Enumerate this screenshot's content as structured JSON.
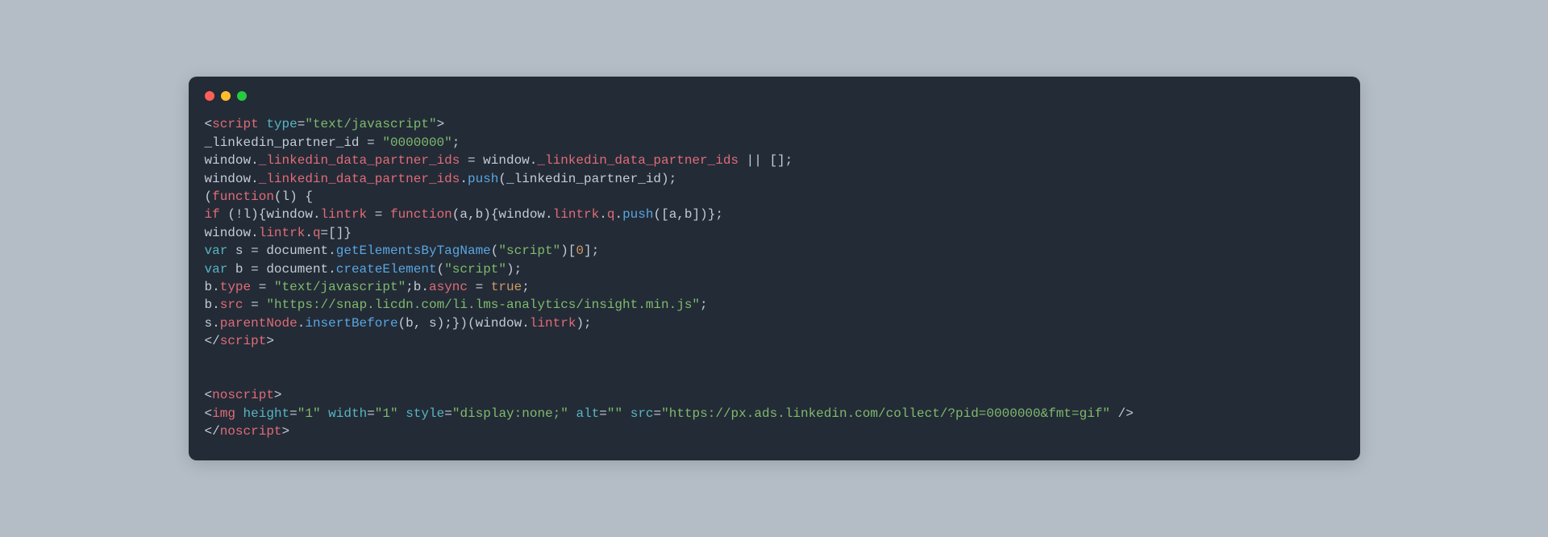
{
  "window": {
    "traffic_lights": [
      "red",
      "yellow",
      "green"
    ]
  },
  "code": {
    "lines": [
      [
        {
          "t": "<",
          "c": "punct"
        },
        {
          "t": "script",
          "c": "tag"
        },
        {
          "t": " ",
          "c": "punct"
        },
        {
          "t": "type",
          "c": "attr"
        },
        {
          "t": "=",
          "c": "punct"
        },
        {
          "t": "\"text/javascript\"",
          "c": "string"
        },
        {
          "t": ">",
          "c": "punct"
        }
      ],
      [
        {
          "t": "_linkedin_partner_id ",
          "c": "ident"
        },
        {
          "t": "= ",
          "c": "punct"
        },
        {
          "t": "\"0000000\"",
          "c": "string"
        },
        {
          "t": ";",
          "c": "punct"
        }
      ],
      [
        {
          "t": "window",
          "c": "ident"
        },
        {
          "t": ".",
          "c": "punct"
        },
        {
          "t": "_linkedin_data_partner_ids",
          "c": "prop"
        },
        {
          "t": " = ",
          "c": "punct"
        },
        {
          "t": "window",
          "c": "ident"
        },
        {
          "t": ".",
          "c": "punct"
        },
        {
          "t": "_linkedin_data_partner_ids",
          "c": "prop"
        },
        {
          "t": " || [];",
          "c": "punct"
        }
      ],
      [
        {
          "t": "window",
          "c": "ident"
        },
        {
          "t": ".",
          "c": "punct"
        },
        {
          "t": "_linkedin_data_partner_ids",
          "c": "prop"
        },
        {
          "t": ".",
          "c": "punct"
        },
        {
          "t": "push",
          "c": "func"
        },
        {
          "t": "(",
          "c": "punct"
        },
        {
          "t": "_linkedin_partner_id",
          "c": "ident"
        },
        {
          "t": ");",
          "c": "punct"
        }
      ],
      [
        {
          "t": "(",
          "c": "punct"
        },
        {
          "t": "function",
          "c": "keyword"
        },
        {
          "t": "(",
          "c": "punct"
        },
        {
          "t": "l",
          "c": "ident"
        },
        {
          "t": ") {",
          "c": "punct"
        }
      ],
      [
        {
          "t": "if ",
          "c": "keyword"
        },
        {
          "t": "(!",
          "c": "punct"
        },
        {
          "t": "l",
          "c": "ident"
        },
        {
          "t": "){",
          "c": "punct"
        },
        {
          "t": "window",
          "c": "ident"
        },
        {
          "t": ".",
          "c": "punct"
        },
        {
          "t": "lintrk",
          "c": "prop"
        },
        {
          "t": " = ",
          "c": "punct"
        },
        {
          "t": "function",
          "c": "keyword"
        },
        {
          "t": "(",
          "c": "punct"
        },
        {
          "t": "a",
          "c": "ident"
        },
        {
          "t": ",",
          "c": "punct"
        },
        {
          "t": "b",
          "c": "ident"
        },
        {
          "t": "){",
          "c": "punct"
        },
        {
          "t": "window",
          "c": "ident"
        },
        {
          "t": ".",
          "c": "punct"
        },
        {
          "t": "lintrk",
          "c": "prop"
        },
        {
          "t": ".",
          "c": "punct"
        },
        {
          "t": "q",
          "c": "prop"
        },
        {
          "t": ".",
          "c": "punct"
        },
        {
          "t": "push",
          "c": "func"
        },
        {
          "t": "([",
          "c": "punct"
        },
        {
          "t": "a",
          "c": "ident"
        },
        {
          "t": ",",
          "c": "punct"
        },
        {
          "t": "b",
          "c": "ident"
        },
        {
          "t": "])};",
          "c": "punct"
        }
      ],
      [
        {
          "t": "window",
          "c": "ident"
        },
        {
          "t": ".",
          "c": "punct"
        },
        {
          "t": "lintrk",
          "c": "prop"
        },
        {
          "t": ".",
          "c": "punct"
        },
        {
          "t": "q",
          "c": "prop"
        },
        {
          "t": "=[]}",
          "c": "punct"
        }
      ],
      [
        {
          "t": "var",
          "c": "var"
        },
        {
          "t": " s = ",
          "c": "ident"
        },
        {
          "t": "document",
          "c": "ident"
        },
        {
          "t": ".",
          "c": "punct"
        },
        {
          "t": "getElementsByTagName",
          "c": "func"
        },
        {
          "t": "(",
          "c": "punct"
        },
        {
          "t": "\"script\"",
          "c": "string"
        },
        {
          "t": ")[",
          "c": "punct"
        },
        {
          "t": "0",
          "c": "num"
        },
        {
          "t": "];",
          "c": "punct"
        }
      ],
      [
        {
          "t": "var",
          "c": "var"
        },
        {
          "t": " b = ",
          "c": "ident"
        },
        {
          "t": "document",
          "c": "ident"
        },
        {
          "t": ".",
          "c": "punct"
        },
        {
          "t": "createElement",
          "c": "func"
        },
        {
          "t": "(",
          "c": "punct"
        },
        {
          "t": "\"script\"",
          "c": "string"
        },
        {
          "t": ");",
          "c": "punct"
        }
      ],
      [
        {
          "t": "b",
          "c": "ident"
        },
        {
          "t": ".",
          "c": "punct"
        },
        {
          "t": "type",
          "c": "prop"
        },
        {
          "t": " = ",
          "c": "punct"
        },
        {
          "t": "\"text/javascript\"",
          "c": "string"
        },
        {
          "t": ";",
          "c": "punct"
        },
        {
          "t": "b",
          "c": "ident"
        },
        {
          "t": ".",
          "c": "punct"
        },
        {
          "t": "async",
          "c": "prop"
        },
        {
          "t": " = ",
          "c": "punct"
        },
        {
          "t": "true",
          "c": "bool"
        },
        {
          "t": ";",
          "c": "punct"
        }
      ],
      [
        {
          "t": "b",
          "c": "ident"
        },
        {
          "t": ".",
          "c": "punct"
        },
        {
          "t": "src",
          "c": "prop"
        },
        {
          "t": " = ",
          "c": "punct"
        },
        {
          "t": "\"https://snap.licdn.com/li.lms-analytics/insight.min.js\"",
          "c": "string"
        },
        {
          "t": ";",
          "c": "punct"
        }
      ],
      [
        {
          "t": "s",
          "c": "ident"
        },
        {
          "t": ".",
          "c": "punct"
        },
        {
          "t": "parentNode",
          "c": "prop"
        },
        {
          "t": ".",
          "c": "punct"
        },
        {
          "t": "insertBefore",
          "c": "func"
        },
        {
          "t": "(",
          "c": "punct"
        },
        {
          "t": "b",
          "c": "ident"
        },
        {
          "t": ", ",
          "c": "punct"
        },
        {
          "t": "s",
          "c": "ident"
        },
        {
          "t": ");})(",
          "c": "punct"
        },
        {
          "t": "window",
          "c": "ident"
        },
        {
          "t": ".",
          "c": "punct"
        },
        {
          "t": "lintrk",
          "c": "prop"
        },
        {
          "t": ");",
          "c": "punct"
        }
      ],
      [
        {
          "t": "</",
          "c": "punct"
        },
        {
          "t": "script",
          "c": "tag"
        },
        {
          "t": ">",
          "c": "punct"
        }
      ],
      [],
      [],
      [
        {
          "t": "<",
          "c": "punct"
        },
        {
          "t": "noscript",
          "c": "tag"
        },
        {
          "t": ">",
          "c": "punct"
        }
      ],
      [
        {
          "t": "<",
          "c": "punct"
        },
        {
          "t": "img",
          "c": "tag"
        },
        {
          "t": " ",
          "c": "punct"
        },
        {
          "t": "height",
          "c": "attr"
        },
        {
          "t": "=",
          "c": "punct"
        },
        {
          "t": "\"1\"",
          "c": "string"
        },
        {
          "t": " ",
          "c": "punct"
        },
        {
          "t": "width",
          "c": "attr"
        },
        {
          "t": "=",
          "c": "punct"
        },
        {
          "t": "\"1\"",
          "c": "string"
        },
        {
          "t": " ",
          "c": "punct"
        },
        {
          "t": "style",
          "c": "attr"
        },
        {
          "t": "=",
          "c": "punct"
        },
        {
          "t": "\"display:none;\"",
          "c": "string"
        },
        {
          "t": " ",
          "c": "punct"
        },
        {
          "t": "alt",
          "c": "attr"
        },
        {
          "t": "=",
          "c": "punct"
        },
        {
          "t": "\"\"",
          "c": "string"
        },
        {
          "t": " ",
          "c": "punct"
        },
        {
          "t": "src",
          "c": "attr"
        },
        {
          "t": "=",
          "c": "punct"
        },
        {
          "t": "\"https://px.ads.linkedin.com/collect/?pid=0000000&fmt=gif\"",
          "c": "string"
        },
        {
          "t": " />",
          "c": "punct"
        }
      ],
      [
        {
          "t": "</",
          "c": "punct"
        },
        {
          "t": "noscript",
          "c": "tag"
        },
        {
          "t": ">",
          "c": "punct"
        }
      ]
    ]
  }
}
